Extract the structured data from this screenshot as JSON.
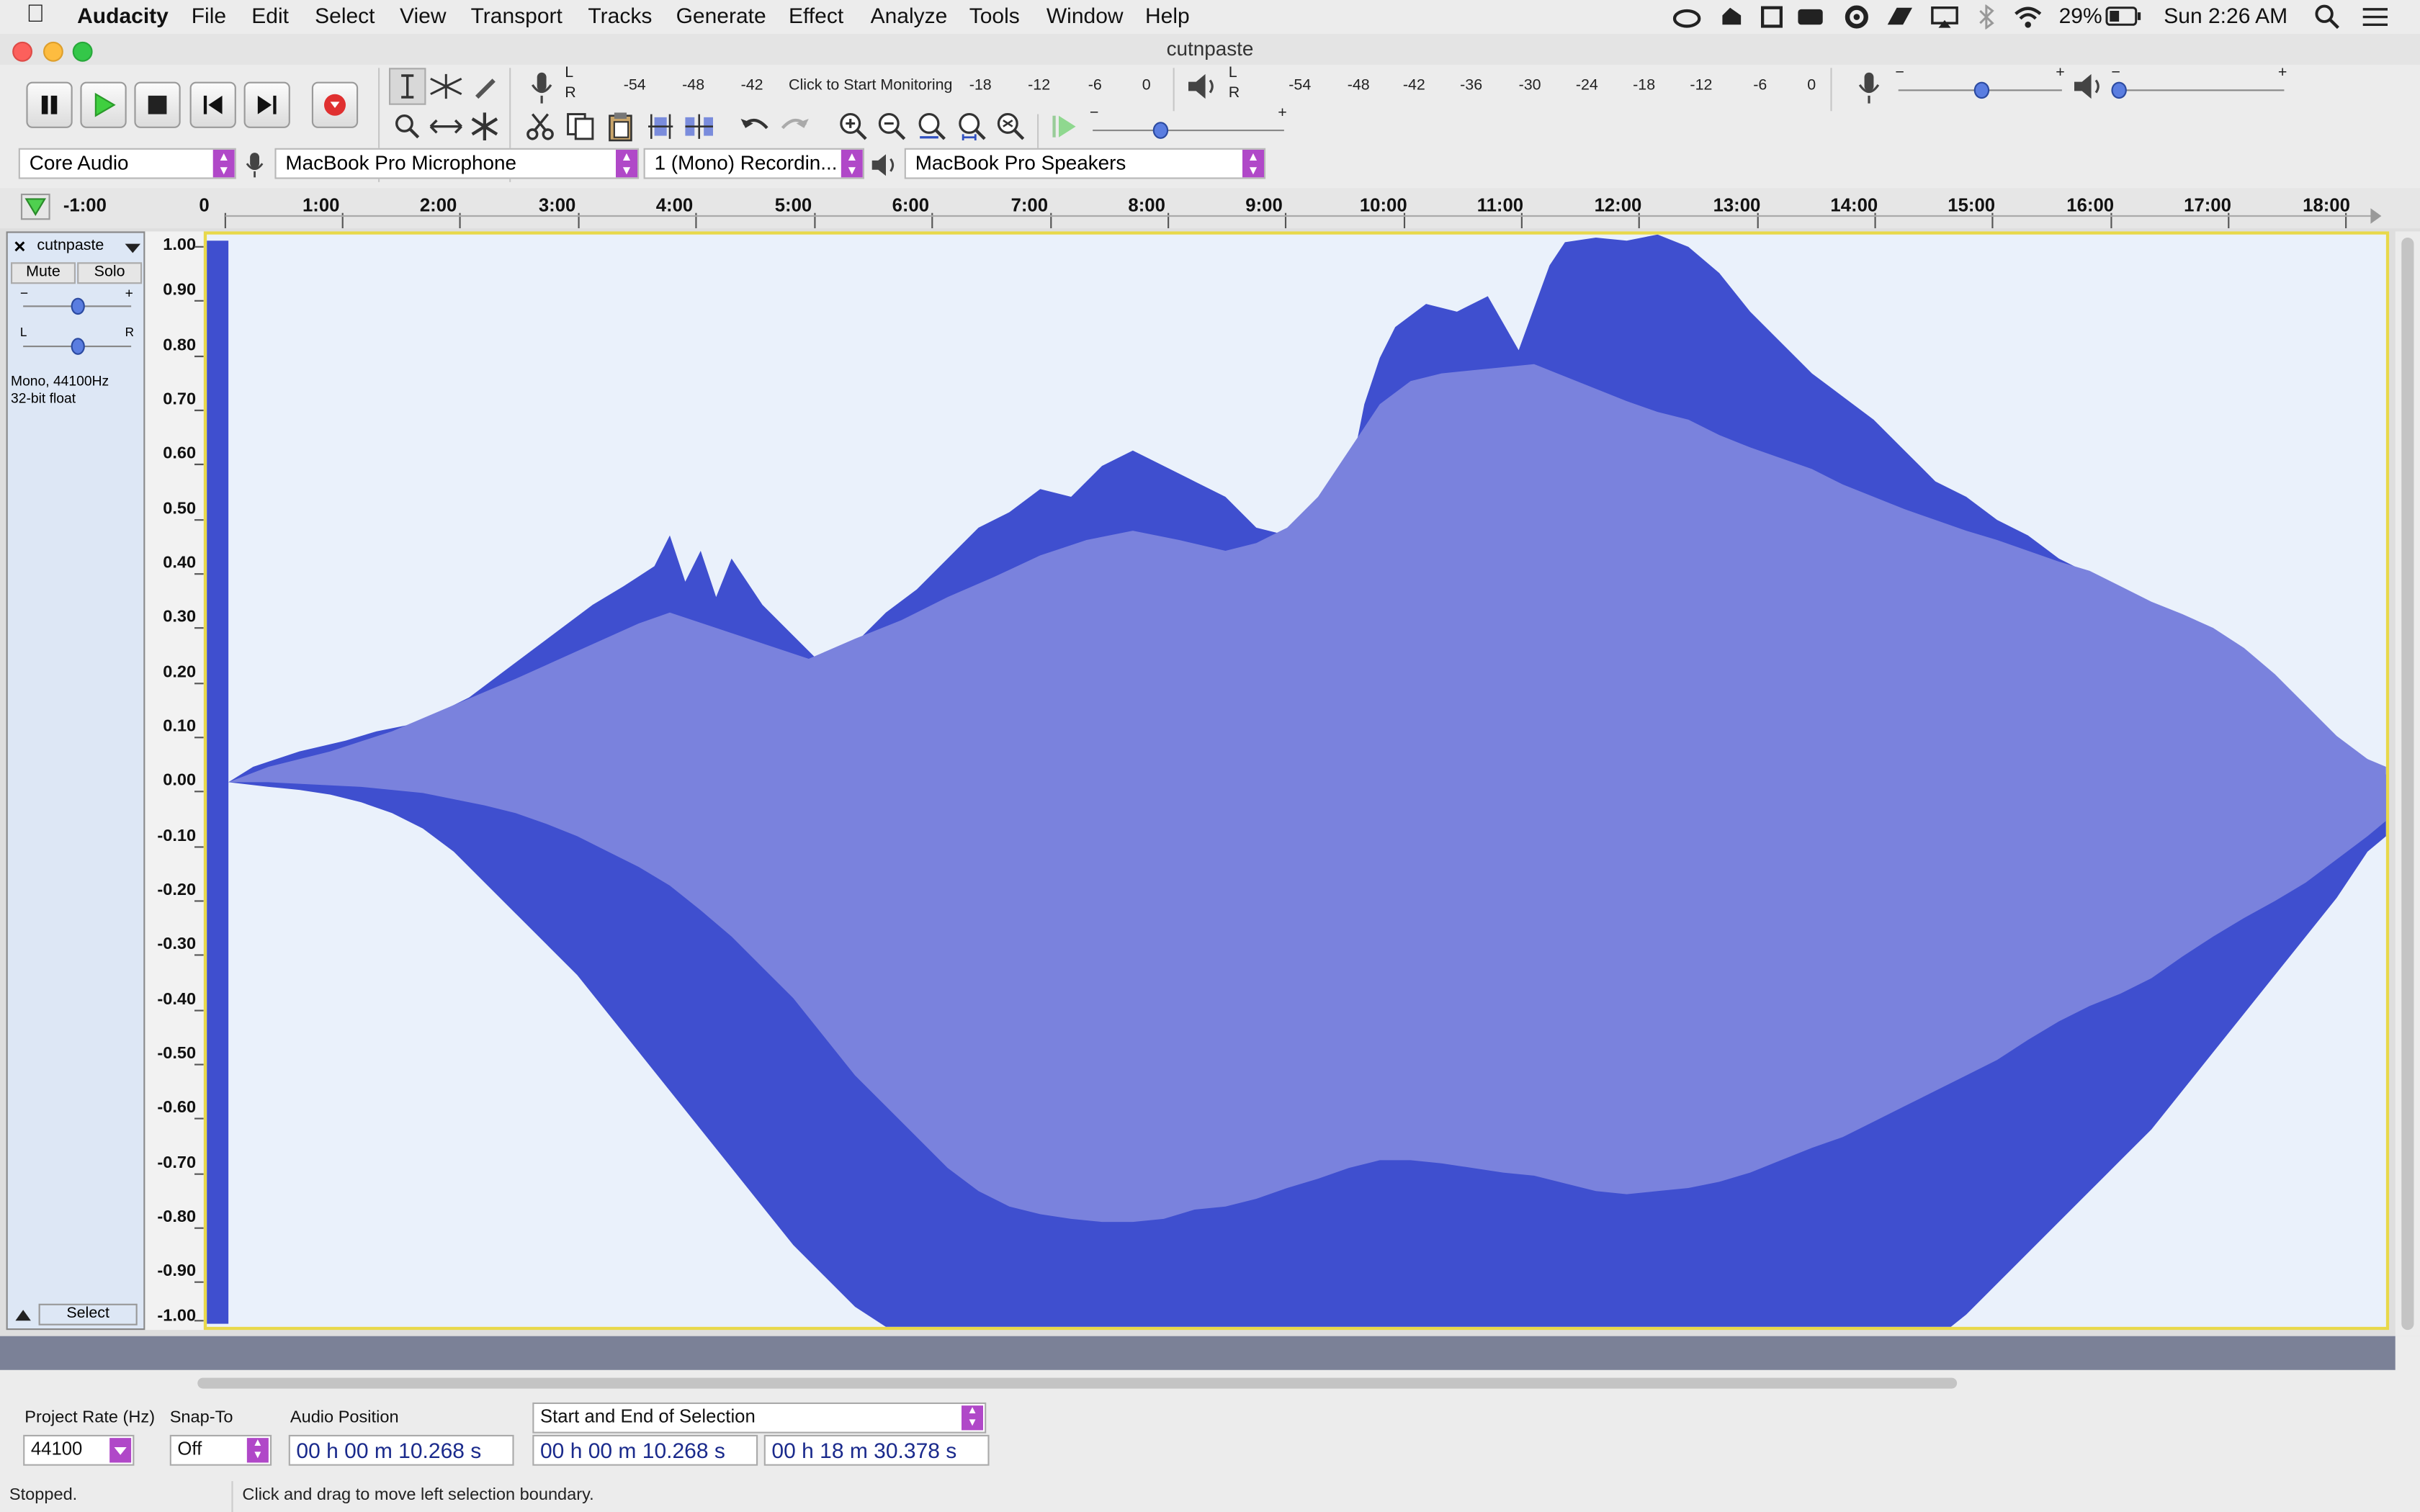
{
  "menubar": {
    "app_name": "Audacity",
    "items": [
      "File",
      "Edit",
      "Select",
      "View",
      "Transport",
      "Tracks",
      "Generate",
      "Effect",
      "Analyze",
      "Tools",
      "Window",
      "Help"
    ],
    "battery": "29%",
    "clock": "Sun 2:26 AM"
  },
  "window": {
    "title": "cutnpaste"
  },
  "meters": {
    "rec_ticks": [
      "-54",
      "-48",
      "-42",
      "Click to Start Monitoring",
      "-18",
      "-12",
      "-6",
      "0"
    ],
    "play_ticks": [
      "-54",
      "-48",
      "-42",
      "-36",
      "-30",
      "-24",
      "-18",
      "-12",
      "-6",
      "0"
    ],
    "lr": [
      "L",
      "R"
    ]
  },
  "devices": {
    "host": "Core Audio",
    "input": "MacBook Pro Microphone",
    "channels": "1 (Mono) Recordin...",
    "output": "MacBook Pro Speakers"
  },
  "ruler": {
    "labels": [
      "-1:00",
      "0",
      "1:00",
      "2:00",
      "3:00",
      "4:00",
      "5:00",
      "6:00",
      "7:00",
      "8:00",
      "9:00",
      "10:00",
      "11:00",
      "12:00",
      "13:00",
      "14:00",
      "15:00",
      "16:00",
      "17:00",
      "18:00"
    ]
  },
  "track": {
    "name": "cutnpaste",
    "mute": "Mute",
    "solo": "Solo",
    "info1": "Mono, 44100Hz",
    "info2": "32-bit float",
    "select": "Select",
    "close": "×",
    "gain_minus": "−",
    "gain_plus": "+",
    "pan_l": "L",
    "pan_r": "R"
  },
  "vruler": {
    "labels": [
      "1.00",
      "0.90",
      "0.80",
      "0.70",
      "0.60",
      "0.50",
      "0.40",
      "0.30",
      "0.20",
      "0.10",
      "0.00",
      "-0.10",
      "-0.20",
      "-0.30",
      "-0.40",
      "-0.50",
      "-0.60",
      "-0.70",
      "-0.80",
      "-0.90",
      "-1.00"
    ]
  },
  "selection_bar": {
    "rate_label": "Project Rate (Hz)",
    "rate_value": "44100",
    "snap_label": "Snap-To",
    "snap_value": "Off",
    "pos_label": "Audio Position",
    "pos_value": "00 h 00 m 10.268 s",
    "sel_mode": "Start and End of Selection",
    "sel_start": "00 h 00 m 10.268 s",
    "sel_end": "00 h 18 m 30.378 s"
  },
  "status": {
    "state": "Stopped.",
    "hint": "Click and drag to move left selection boundary."
  },
  "colors": {
    "wave_dark": "#3f4fcf",
    "wave_light": "#7a82dd",
    "track_bg": "#eaf1fb",
    "accent": "#b048c8"
  }
}
